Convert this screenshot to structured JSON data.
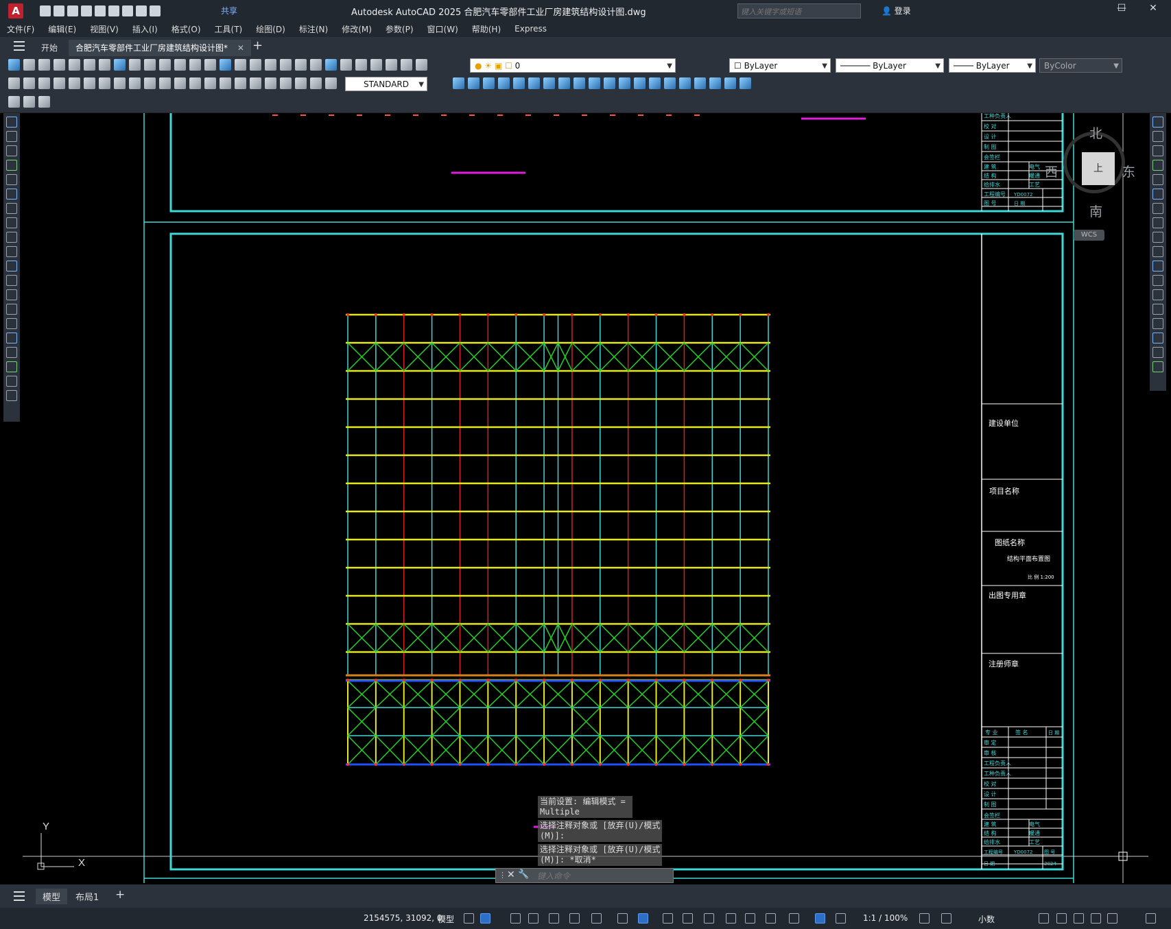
{
  "app": {
    "logo": "A",
    "title": "Autodesk AutoCAD 2025    合肥汽车零部件工业厂房建筑结构设计图.dwg",
    "share": "共享",
    "search_placeholder": "键入关键字或短语",
    "login": "登录",
    "window_controls": [
      "—",
      "☐",
      "✕"
    ]
  },
  "menu": [
    "文件(F)",
    "编辑(E)",
    "视图(V)",
    "插入(I)",
    "格式(O)",
    "工具(T)",
    "绘图(D)",
    "标注(N)",
    "修改(M)",
    "参数(P)",
    "窗口(W)",
    "帮助(H)",
    "Express"
  ],
  "file_tabs": {
    "start": "开始",
    "active": "合肥汽车零部件工业厂房建筑结构设计图*",
    "close": "✕",
    "add": "+"
  },
  "properties": {
    "layer": "0",
    "color": "ByLayer",
    "linetype": "ByLayer",
    "lineweight": "ByLayer",
    "plotstyle": "ByColor",
    "dim_style": "STANDARD"
  },
  "viewcube": {
    "north": "北",
    "south": "南",
    "east": "东",
    "west": "西",
    "face": "上",
    "wcs": "WCS"
  },
  "ucs": {
    "x": "X",
    "y": "Y"
  },
  "titleblock": {
    "top_rows": [
      "工种负责人",
      "校  对",
      "设  计",
      "制  图",
      "会签栏",
      "建  筑",
      "电气",
      "结  构",
      "暖通",
      "给排水",
      "工艺",
      "工程编号",
      "YD0072",
      "图  号",
      "日  期",
      "2024"
    ],
    "build_unit": "建设单位",
    "project_name": "项目名称",
    "drawing_name": "图纸名称",
    "drawing_title": "结构平面布置图",
    "scale_note": "比 例   1:200",
    "issue_seal": "出图专用章",
    "reg_seal": "注册师章",
    "sig_header": [
      "专 业",
      "签 名",
      "日 期"
    ],
    "sig_rows": [
      "审  定",
      "审  核",
      "工程负责人",
      "工种负责人",
      "校  对",
      "设  计",
      "制  图"
    ],
    "cosign_rows": [
      "会签栏",
      "建  筑",
      "电气",
      "结  构",
      "暖通",
      "给排水",
      "工艺"
    ],
    "bottom_rows": [
      "工程编号",
      "YD0072",
      "图  号",
      "日  期",
      "2024"
    ]
  },
  "command": {
    "history": [
      "当前设置: 编辑模式 = \nMultiple",
      "选择注释对象或 [放弃(U)/模式\n(M)]:",
      "选择注释对象或 [放弃(U)/模式\n(M)]: *取消*"
    ],
    "placeholder": "键入命令",
    "close": "✕"
  },
  "layout_tabs": [
    "模型",
    "布局1",
    "+"
  ],
  "status": {
    "coords": "2154575, 31092, 0",
    "model": "模型",
    "scale": "1:1 / 100%",
    "units": "小数"
  }
}
